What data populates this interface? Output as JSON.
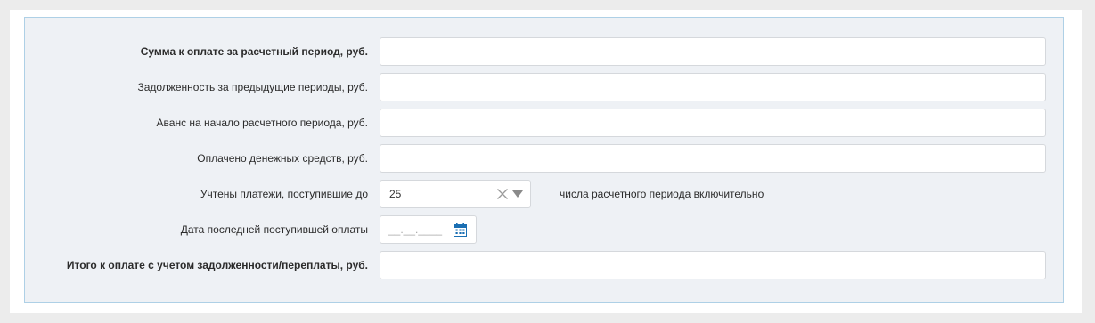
{
  "form": {
    "amount_due": {
      "label": "Сумма к оплате за расчетный период, руб.",
      "value": ""
    },
    "previous_debt": {
      "label": "Задолженность за предыдущие периоды, руб.",
      "value": ""
    },
    "advance": {
      "label": "Аванс на начало расчетного периода, руб.",
      "value": ""
    },
    "paid": {
      "label": "Оплачено денежных средств, руб.",
      "value": ""
    },
    "payments_until": {
      "label": "Учтены платежи, поступившие до",
      "selected_value": "25",
      "suffix": "числа расчетного периода включительно",
      "clear_icon": "clear-x-icon",
      "dropdown_icon": "caret-down-icon"
    },
    "last_payment_date": {
      "label": "Дата последней поступившей оплаты",
      "placeholder": "__.__.____",
      "icon": "calendar-icon"
    },
    "total": {
      "label": "Итого к оплате с учетом задолженности/переплаты, руб.",
      "value": ""
    }
  },
  "colors": {
    "panel_bg": "#eef1f5",
    "panel_border": "#aed0e6",
    "icon_blue": "#1a6fb3",
    "icon_gray": "#8a8a8a"
  }
}
